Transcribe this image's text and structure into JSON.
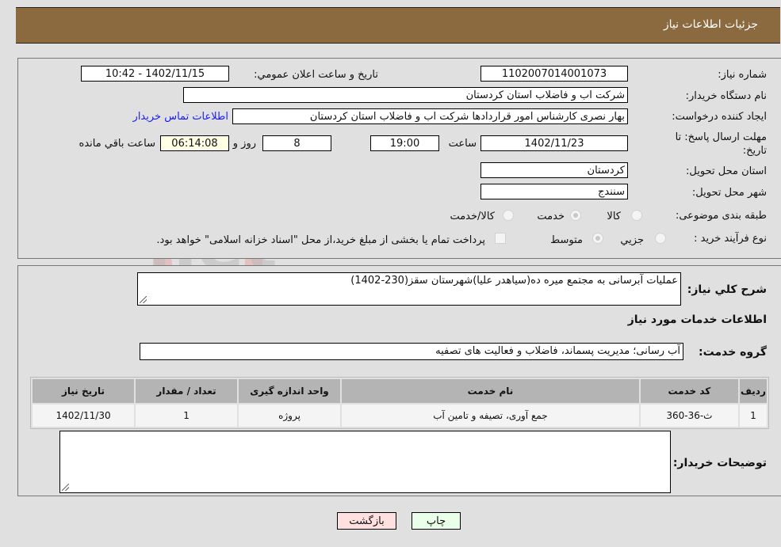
{
  "header": {
    "title": "جزئیات اطلاعات نیاز"
  },
  "form": {
    "need_number_label": "شماره نیاز:",
    "need_number": "1102007014001073",
    "announce_label": "تاریخ و ساعت اعلان عمومي:",
    "announce_value": "1402/11/15 - 10:42",
    "buyer_label": "نام دستگاه خریدار:",
    "buyer_value": "شرکت اب و فاضلاب استان کردستان",
    "creator_label": "ایجاد کننده درخواست:",
    "creator_value": "بهار نصری کارشناس امور قراردادها شرکت اب و فاضلاب استان کردستان",
    "contact_link": "اطلاعات تماس خریدار",
    "deadline_label_1": "مهلت ارسال پاسخ: تا",
    "deadline_label_2": "تاریخ:",
    "deadline_date": "1402/11/23",
    "time_label": "ساعت",
    "deadline_time": "19:00",
    "days_value": "8",
    "days_label": "روز و",
    "remaining_time": "06:14:08",
    "remaining_label": "ساعت باقي مانده",
    "province_label": "استان محل تحویل:",
    "province_value": "کردستان",
    "city_label": "شهر محل تحویل:",
    "city_value": "سنندج",
    "category_label": "طبقه بندی موضوعی:",
    "category_options": [
      {
        "label": "کالا",
        "selected": false
      },
      {
        "label": "خدمت",
        "selected": true
      },
      {
        "label": "کالا/خدمت",
        "selected": false
      }
    ],
    "process_label": "نوع فرآیند خرید :",
    "process_options": [
      {
        "label": "جزیي",
        "selected": false
      },
      {
        "label": "متوسط",
        "selected": true
      }
    ],
    "treasury_note": "پرداخت تمام یا بخشی از مبلغ خرید،از محل \"اسناد خزانه اسلامی\" خواهد بود.",
    "treasury_checked": false
  },
  "details": {
    "description_label": "شرح کلي نیاز:",
    "description_value": "عملیات آبرسانی به مجتمع میره ده(سیاهدر علیا)شهرستان سقز(230-1402)",
    "services_heading": "اطلاعات خدمات مورد نیاز",
    "service_group_label": "گروه خدمت:",
    "service_group_value": "آب رسانی؛ مدیریت پسماند، فاضلاب و فعالیت های تصفیه",
    "table": {
      "headers": [
        "ردیف",
        "کد خدمت",
        "نام خدمت",
        "واحد اندازه گیری",
        "تعداد / مقدار",
        "تاریخ نیاز"
      ],
      "rows": [
        [
          "1",
          "ث-36-360",
          "جمع آوری، تصیفه و تامین آب",
          "پروژه",
          "1",
          "1402/11/30"
        ]
      ]
    },
    "buyer_notes_label": "توضیحات خریدار:",
    "buyer_notes_value": ""
  },
  "buttons": {
    "print": "چاپ",
    "back": "بازگشت"
  },
  "colors": {
    "header_bg": "#8b6a40",
    "print_bg": "#eaffea",
    "back_bg": "#ffe0e0",
    "link": "#1a1aff"
  },
  "watermark": "AriaTender.net"
}
